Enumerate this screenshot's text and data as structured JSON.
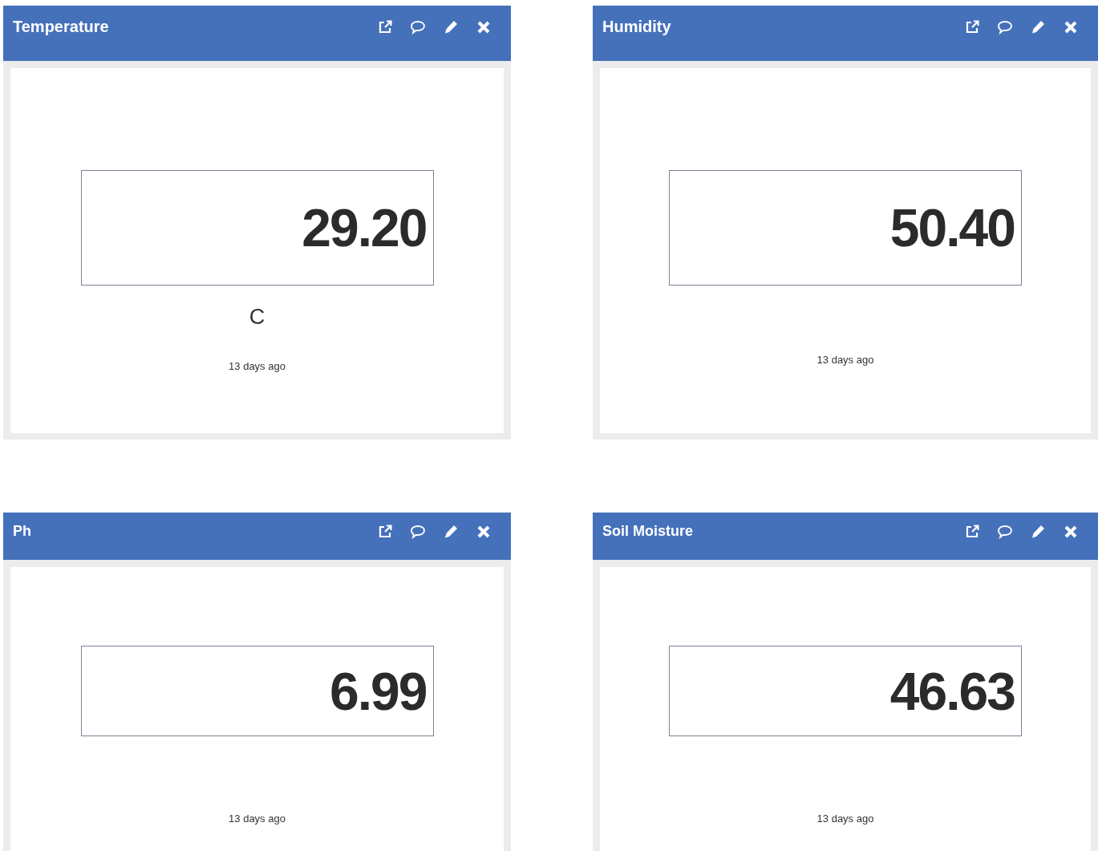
{
  "widgets": [
    {
      "title": "Temperature",
      "value": "29.20",
      "unit": "C",
      "updated": "13 days ago"
    },
    {
      "title": "Humidity",
      "value": "50.40",
      "updated": "13 days ago"
    },
    {
      "title": "Ph",
      "value": "6.99",
      "updated": "13 days ago"
    },
    {
      "title": "Soil Moisture",
      "value": "46.63",
      "updated": "13 days ago"
    }
  ]
}
